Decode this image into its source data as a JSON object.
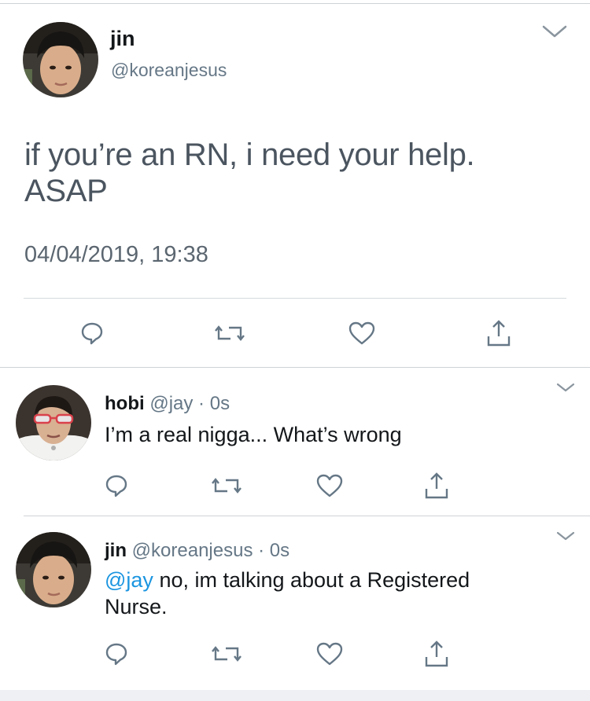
{
  "main_tweet": {
    "name": "jin",
    "handle": "@koreanjesus",
    "text_line1": "if you’re an RN, i need your help.",
    "text_line2": "ASAP",
    "timestamp": "04/04/2019, 19:38"
  },
  "replies": [
    {
      "name": "hobi",
      "handle": "@jay",
      "separator": "·",
      "time": "0s",
      "mention": "",
      "text": "I’m a real nigga... What’s wrong"
    },
    {
      "name": "jin",
      "handle": "@koreanjesus",
      "separator": "·",
      "time": "0s",
      "mention": "@jay",
      "text": " no, im talking about a Registered Nurse."
    }
  ],
  "icons": [
    "reply-icon",
    "retweet-icon",
    "like-icon",
    "share-icon",
    "chevron-down-icon"
  ],
  "colors": {
    "mention": "#1b95e0",
    "icon_gray": "#657786",
    "divider": "#d5d9dc"
  }
}
